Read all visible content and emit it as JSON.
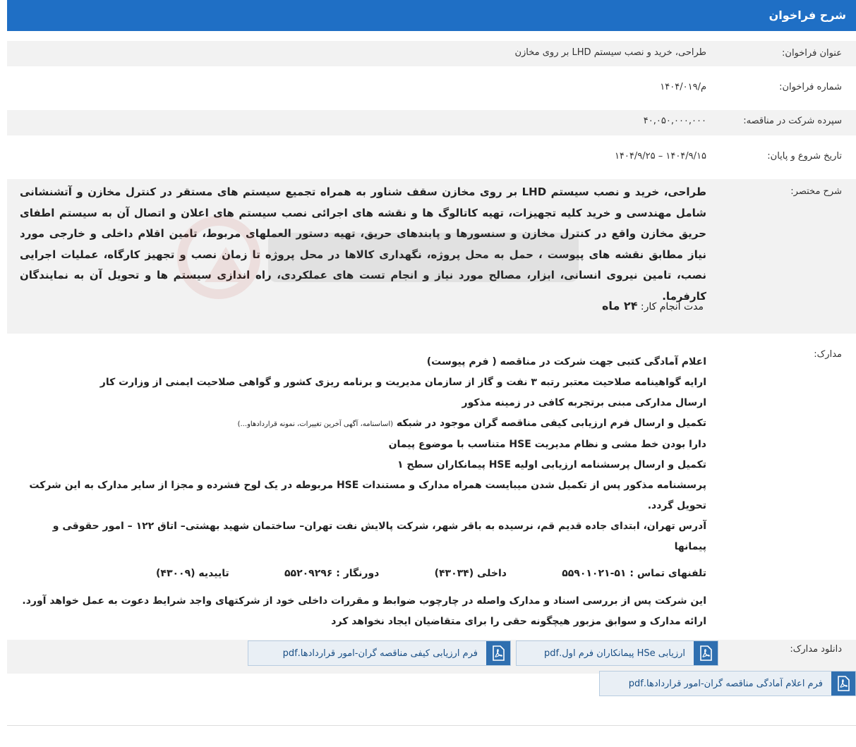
{
  "header": {
    "title": "شرح فراخوان"
  },
  "fields": {
    "title_label": "عنوان فراخوان:",
    "title_value": "طراحی، خرید و نصب سیستم LHD بر روی مخازن",
    "number_label": "شماره فراخوان:",
    "number_value": "م/۱۴۰۴/۰۱۹",
    "deposit_label": "سپرده شرکت در مناقصه:",
    "deposit_value": "۴۰,۰۵۰,۰۰۰,۰۰۰",
    "dates_label": "تاریخ شروع و پایان:",
    "dates_value": "۱۴۰۴/۹/۱۵ – ۱۴۰۴/۹/۲۵",
    "summary_label": "شرح مختصر:",
    "summary_text": "طراحی، خرید و نصب سیستم LHD بر روی مخازن سقف شناور به همراه تجمیع سیستم های مستقر در کنترل مخازن و آتشنشانی شامل مهندسی و خرید کلیه تجهیزات، تهیه کاتالوگ ها و نقشه های اجرائی نصب سیستم های اعلان و اتصال آن به سیستم اطفای حریق مخازن واقع در کنترل مخازن و سنسورها و پابندهای حریق، تهیه دستور العملهای مربوط، تامین اقلام داخلی و خارجی مورد نیاز مطابق نقشه های پیوست ، حمل به محل پروژه، نگهداری کالاها در محل پروژه تا زمان نصب و تجهیز کارگاه، عملیات اجرایی نصب، تامین نیروی انسانی، ابزار، مصالح مورد نیاز و انجام تست های عملکردی، راه اندازی سیستم ها و تحویل آن به نمایندگان کارفرما.",
    "duration_label": "مدت انجام کار:",
    "duration_value": "۲۴ ماه",
    "docs_label": "مدارک:",
    "docs_lines": [
      "اعلام آمادگی کتبی جهت شرکت در مناقصه ( فرم پیوست)",
      "ارایه  گواهینامه صلاحیت معتبر رتبه ۳ نفت و گاز از سازمان مدیریت و برنامه ریزی کشور و گواهی صلاحیت ایمنی از وزارت کار",
      "ارسال مدارکی مبنی برتجربه کافی در زمینه مذکور"
    ],
    "docs_line4_main": "تکمیل و ارسال فرم ارزیابی کیفی مناقصه گران موجود در شبکه",
    "docs_line4_small": "(اساسنامه، آگهی آخرین تغییرات، نمونه قراردادهاو...)",
    "docs_lines2": [
      "دارا بودن خط مشی و نظام مدیریت HSE متناسب با موضوع پیمان",
      "تکمیل و ارسال پرسشنامه ارزیابی اولیه HSE پیمانکاران سطح ۱",
      " پرسشنامه مذکور پس از تکمیل شدن میبایست همراه مدارک و مستندات HSE مربوطه در یک لوح فشرده و مجزا از سایر مدارک به این شرکت تحویل گردد.",
      "آدرس تهران، ابتدای جاده قدیم قم، نرسیده به باقر شهر، شرکت پالایش نفت تهران– ساختمان شهید بهشتی– اتاق ۱۲۲ – امور حقوقی و پیمانها"
    ],
    "phone_main": "تلفنهای تماس : ۵۱-۵۵۹۰۱۰۲۱",
    "phone_internal": "داخلی (۴۳۰۳۴)",
    "fax": "دورنگار : ۵۵۲۰۹۲۹۶",
    "confirm": "تاییدیه (۴۳۰۰۹)",
    "closing": "این شرکت پس از بررسی اسناد و مدارک واصله در چارچوب ضوابط و مقررات داخلی خود از شرکتهای واجد شرایط دعوت به عمل خواهد آورد. ارائه مدارک و سوابق مزبور هیچگونه حقی را برای متقاضیان ایجاد نخواهد کرد",
    "download_label": "دانلود مدارک:"
  },
  "downloads": [
    "ارزیابی HSe پیمانکاران فرم اول.pdf",
    "فرم ارزیابی کیفی مناقصه گران-امور قراردادها.pdf",
    "فرم اعلام آمادگی مناقصه گران-امور قراردادها.pdf"
  ],
  "icons": {
    "pdf": "pdf-file-icon",
    "watermark": "ariatender-logo"
  },
  "colors": {
    "header": "#1f6fc5",
    "row_gray": "#f2f2f2",
    "pdf_icon": "#2f6fb0"
  }
}
